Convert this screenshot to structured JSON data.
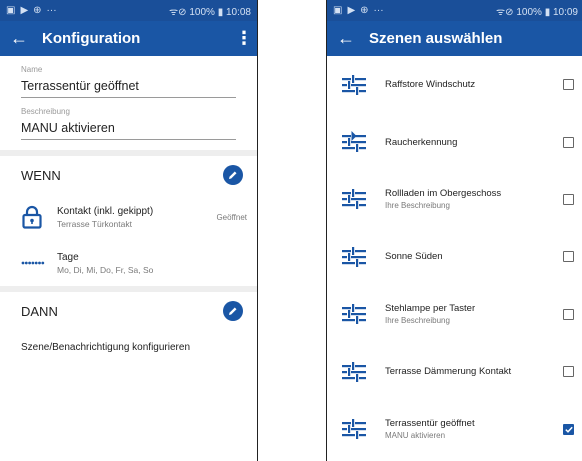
{
  "left": {
    "status": {
      "left_icons": [
        "▣",
        "▶",
        "⊕",
        "···"
      ],
      "right": "ᯤ⊘ 100% ▮ 10:08"
    },
    "appbar": {
      "back": "←",
      "title": "Konfiguration",
      "more": "⋮"
    },
    "name": {
      "label": "Name",
      "value": "Terrassentür geöffnet"
    },
    "beschreibung": {
      "label": "Beschreibung",
      "value": "MANU aktivieren"
    },
    "wenn": {
      "heading": "WENN",
      "conditions": [
        {
          "title": "Kontakt (inkl. gekippt)",
          "sub": "Terrasse Türkontakt",
          "state": "Geöffnet",
          "icon": "lock-icon"
        },
        {
          "title": "Tage",
          "sub": "Mo, Di, Mi, Do, Fr, Sa, So",
          "state": "",
          "icon": "dots-icon"
        }
      ]
    },
    "dann": {
      "heading": "DANN",
      "text": "Szene/Benachrichtigung konfigurieren"
    }
  },
  "right": {
    "status": {
      "left_icons": [
        "▣",
        "▶",
        "⊕",
        "···"
      ],
      "right": "ᯤ⊘ 100% ▮ 10:09"
    },
    "appbar": {
      "back": "←",
      "title": "Szenen auswählen"
    },
    "scenes": [
      {
        "title": "Raffstore Windschutz",
        "sub": "",
        "checked": false,
        "icon": "sliders-icon"
      },
      {
        "title": "Raucherkennung",
        "sub": "",
        "checked": false,
        "icon": "sliders-play-icon"
      },
      {
        "title": "Rollladen im Obergeschoss",
        "sub": "Ihre Beschreibung",
        "checked": false,
        "icon": "sliders-icon"
      },
      {
        "title": "Sonne Süden",
        "sub": "",
        "checked": false,
        "icon": "sliders-icon"
      },
      {
        "title": "Stehlampe per Taster",
        "sub": "Ihre Beschreibung",
        "checked": false,
        "icon": "sliders-icon"
      },
      {
        "title": "Terrasse Dämmerung Kontakt",
        "sub": "",
        "checked": false,
        "icon": "sliders-icon"
      },
      {
        "title": "Terrassentür geöffnet",
        "sub": "MANU aktivieren",
        "checked": true,
        "icon": "sliders-icon"
      }
    ]
  },
  "colors": {
    "appbar": "#1a56a5",
    "statusbar": "#1a4f99",
    "accent": "#1a56a5"
  }
}
